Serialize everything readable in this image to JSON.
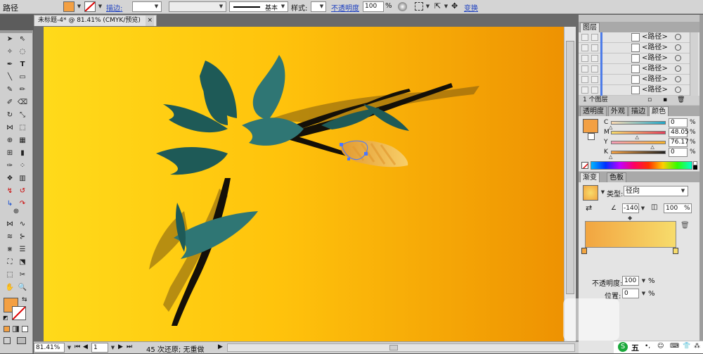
{
  "control_bar": {
    "object_type": "路径",
    "stroke_label": "描边:",
    "stroke_profile": "基本",
    "style_label": "样式:",
    "opacity_label": "不透明度",
    "opacity_value": "100",
    "opacity_unit": "%",
    "transform_label": "变换"
  },
  "document": {
    "tab_title": "未标题-4* @ 81.41% (CMYK/预览)",
    "tab_close": "×"
  },
  "status_bar": {
    "zoom": "81.41%",
    "page": "1",
    "status_text": "45 次还原; 无重做"
  },
  "layers_panel": {
    "tab": "图层",
    "rows": [
      "<路径>",
      "<路径>",
      "<路径>",
      "<路径>",
      "<路径>",
      "<路径>"
    ],
    "footer": "1 个图层"
  },
  "color_panel": {
    "tabs": [
      "透明度",
      "外观",
      "描边",
      "颜色"
    ],
    "channels": [
      {
        "label": "C",
        "value": "0"
      },
      {
        "label": "M",
        "value": "48.05"
      },
      {
        "label": "Y",
        "value": "76.17"
      },
      {
        "label": "K",
        "value": "0"
      }
    ],
    "fill_color": "#f3a043"
  },
  "gradient_panel": {
    "tabs": [
      "渐变",
      "色板"
    ],
    "type_label": "类型:",
    "type_value": "径向",
    "angle_value": "-140.",
    "aspect_value": "100",
    "aspect_unit": "%",
    "opacity_label": "不透明度:",
    "opacity_value": "100",
    "opacity_unit": "%",
    "location_label": "位置:",
    "location_value": "0",
    "location_unit": "%",
    "stops": [
      "#f2a540",
      "#f7dc6c"
    ]
  },
  "taskbar": {
    "ime": "五"
  },
  "colors": {
    "leaf": "#1e5a57",
    "leaf_highlight": "#2f7674",
    "stem": "#141008",
    "shadow": "#7b5a10",
    "bud_light": "#f8cf6a",
    "bud_dark": "#e29a30",
    "selection": "#4a78ff",
    "artboard_left": "#ffda1a",
    "artboard_right": "#ee9202"
  }
}
